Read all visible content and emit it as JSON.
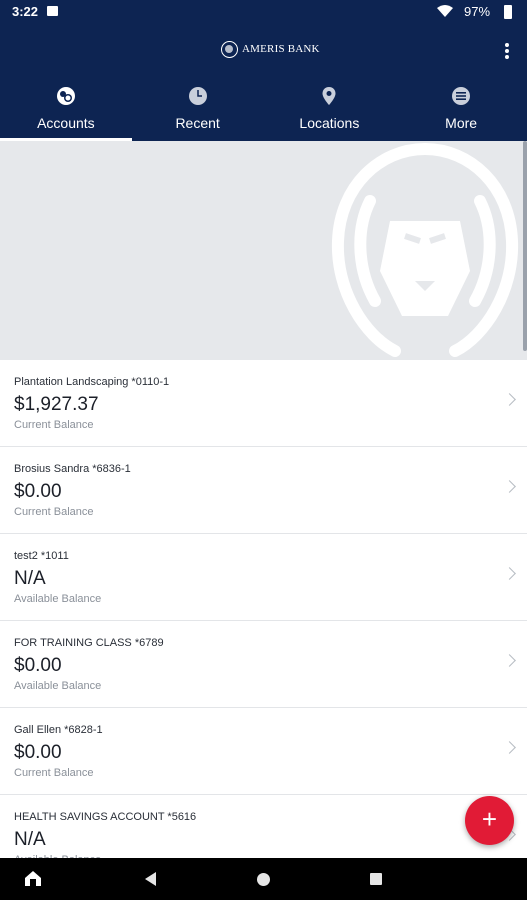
{
  "status_bar": {
    "time": "3:22",
    "battery": "97%"
  },
  "app": {
    "brand": "AMERIS BANK"
  },
  "tabs": [
    {
      "label": "Accounts",
      "icon": "accounts-icon",
      "active": true
    },
    {
      "label": "Recent",
      "icon": "clock-icon",
      "active": false
    },
    {
      "label": "Locations",
      "icon": "location-pin-icon",
      "active": false
    },
    {
      "label": "More",
      "icon": "menu-icon",
      "active": false
    }
  ],
  "accounts": [
    {
      "name": "Plantation Landscaping *0110-1",
      "amount": "$1,927.37",
      "balance_type": "Current Balance"
    },
    {
      "name": "Brosius Sandra *6836-1",
      "amount": "$0.00",
      "balance_type": "Current Balance"
    },
    {
      "name": "test2 *1011",
      "amount": "N/A",
      "balance_type": "Available Balance"
    },
    {
      "name": "FOR TRAINING CLASS *6789",
      "amount": "$0.00",
      "balance_type": "Available Balance"
    },
    {
      "name": "Gall Ellen *6828-1",
      "amount": "$0.00",
      "balance_type": "Current Balance"
    },
    {
      "name": "HEALTH SAVINGS ACCOUNT *5616",
      "amount": "N/A",
      "balance_type": "Available Balance"
    }
  ],
  "fab": {
    "label": "+"
  },
  "colors": {
    "header": "#0d2452",
    "fab": "#e11b36",
    "hero": "#e6e8eb"
  }
}
